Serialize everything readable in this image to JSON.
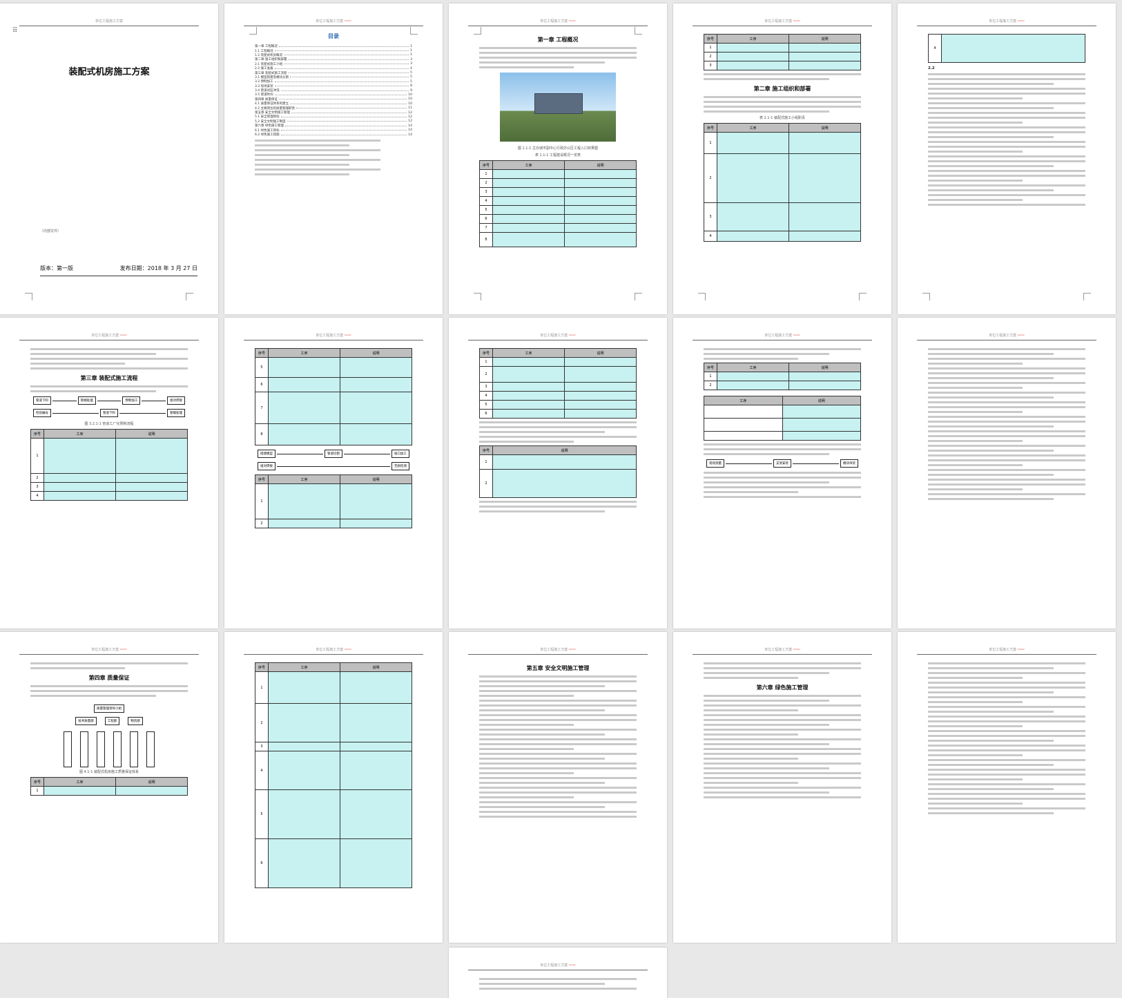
{
  "document": {
    "cover": {
      "title": "装配式机房施工方案",
      "note": "（内部文件）",
      "version": "版本：第一版",
      "date": "发布日期：2018 年 3 月 27 日"
    },
    "toc_title": "目录",
    "toc": [
      "第一章  工程概况",
      "1.1  工程概况",
      "1.2  装配式机房概况",
      "第二章  施工组织和部署",
      "2.1  装配式施工小组",
      "2.2  施工准备",
      "第三章  装配式施工流程",
      "3.1  模型搭建及模块分割",
      "3.2  预制加工",
      "3.3  现场安装",
      "3.4  管道试压冲洗",
      "3.5  管道吹扫",
      "第四章  质量保证",
      "4.1  质量保证体系的建立",
      "4.2  主要岗位的质量管理职责",
      "第五章  安全文明施工管理",
      "5.1  安全管理目标",
      "5.2  安全文明施工制度",
      "第六章  绿色施工管理",
      "6.1  绿色施工目标",
      "6.2  绿色施工措施"
    ],
    "ch1": "第一章  工程概况",
    "ch1_table_caption": "表 1.1-1  工程建设概况一览表",
    "photo_caption": "图 1.1-1 主办城市副中心行政办公区工程入口效果图",
    "ch2": "第二章  施工组织和部署",
    "ch2_table_caption": "表 2.1-1 装配式施工小组职责",
    "ch3": "第三章  装配式施工流程",
    "ch3_fig_caption": "图 3.2.1-1 管道工厂化预制流程",
    "ch4": "第四章  质量保证",
    "ch4_fig_caption": "图 4.1-1 装配式机房施工质量保证体系",
    "ch5": "第五章  安全文明施工管理",
    "ch6": "第六章  绿色施工管理",
    "flow1": [
      "管道下料",
      "管端处理",
      "预制加工",
      "组对焊接",
      "检验编号"
    ],
    "flow2": [
      "搭建模型",
      "管道切割",
      "坡口加工",
      "组对焊接",
      "无损检测"
    ],
    "flow3": [
      "现场测量",
      "支架安装",
      "模块吊装",
      "管道连接",
      "系统调试"
    ],
    "org": [
      "质量管理领导小组",
      "技术质量部",
      "工程部",
      "物资部"
    ],
    "table_headers": [
      "序号",
      "工序",
      "说明"
    ],
    "table_rows": [
      "1",
      "2",
      "3",
      "4",
      "5",
      "6",
      "7",
      "8"
    ],
    "header_text": "单位工程施工方案"
  }
}
